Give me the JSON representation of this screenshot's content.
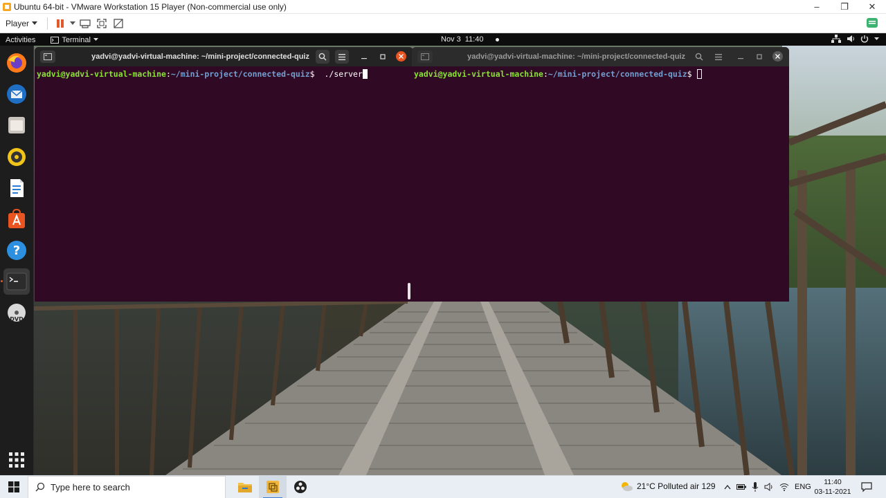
{
  "vm_window": {
    "title": "Ubuntu 64-bit - VMware Workstation 15 Player (Non-commercial use only)",
    "controls": {
      "minimize": "–",
      "maximize": "❐",
      "close": "✕"
    }
  },
  "vm_toolbar": {
    "player_label": "Player"
  },
  "gnome_bar": {
    "activities": "Activities",
    "app_menu": "Terminal",
    "date": "Nov 3",
    "time": "11:40"
  },
  "terminals": {
    "left": {
      "title": "yadvi@yadvi-virtual-machine: ~/mini-project/connected-quiz",
      "prompt_user": "yadvi@yadvi-virtual-machine",
      "prompt_path": "~/mini-project/connected-quiz",
      "prompt_symbol": "$ ",
      "command": "./server"
    },
    "right": {
      "title": "yadvi@yadvi-virtual-machine: ~/mini-project/connected-quiz",
      "prompt_user": "yadvi@yadvi-virtual-machine",
      "prompt_path": "~/mini-project/connected-quiz",
      "prompt_symbol": "$ ",
      "command": ""
    }
  },
  "dock": {
    "items": [
      "firefox-icon",
      "thunderbird-icon",
      "files-icon",
      "rhythmbox-icon",
      "writer-icon",
      "software-icon",
      "help-icon",
      "terminal-icon",
      "dvd-icon",
      "app-grid-icon"
    ]
  },
  "taskbar": {
    "search_placeholder": "Type here to search",
    "weather": "21°C  Polluted air 129",
    "language": "ENG",
    "time": "11:40",
    "date": "03-11-2021"
  },
  "colors": {
    "terminal_bg": "#300a24",
    "prompt_user": "#8ae234",
    "prompt_path": "#729fcf",
    "close_active": "#e95420"
  }
}
